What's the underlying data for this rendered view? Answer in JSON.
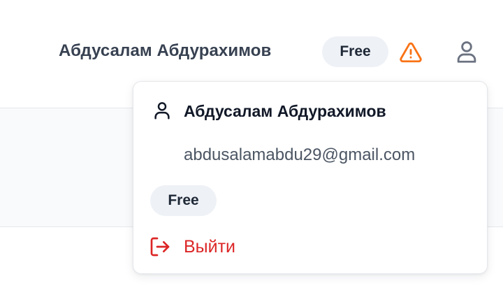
{
  "header": {
    "user_name": "Абдусалам Абдурахимов",
    "plan_badge": "Free",
    "warning_icon": "warning-triangle-icon",
    "account_icon": "user-icon"
  },
  "dropdown": {
    "user_icon": "user-icon",
    "name": "Абдусалам Абдурахимов",
    "email": "abdusalamabdu29@gmail.com",
    "plan_badge": "Free",
    "logout_icon": "logout-icon",
    "logout_label": "Выйти"
  },
  "colors": {
    "warning": "#f97316",
    "danger": "#dc2626",
    "badge_bg": "#eef1f6"
  }
}
